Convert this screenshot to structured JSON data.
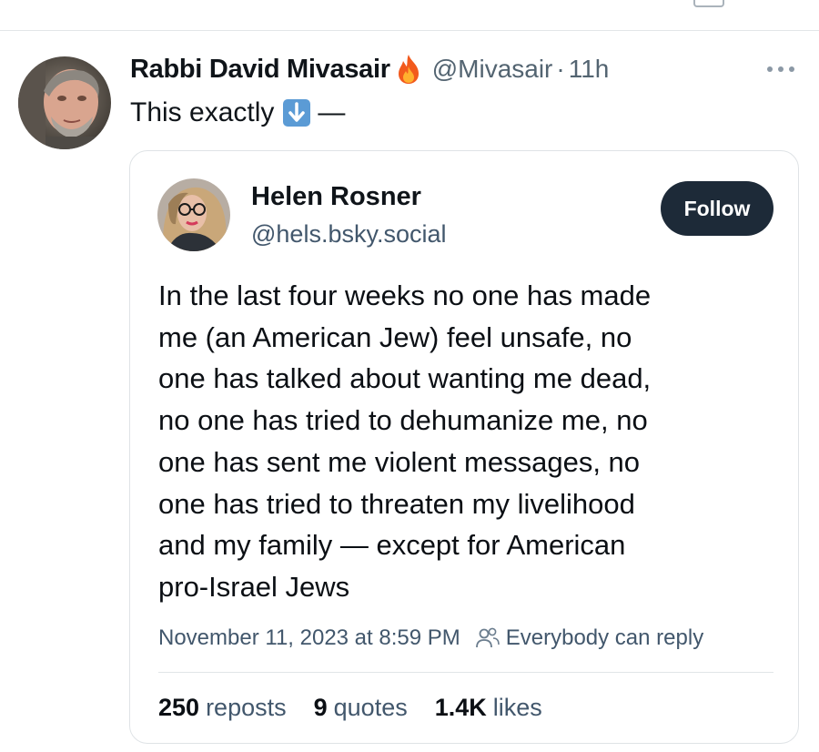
{
  "tweet": {
    "author_name": "Rabbi David Mivasair",
    "author_emoji": "fire-icon",
    "handle": "@Mivasair",
    "separator": "·",
    "time_ago": "11h",
    "text": "This exactly",
    "text_emoji": "arrow-down-icon",
    "text_suffix": "—"
  },
  "quoted_post": {
    "author_name": "Helen Rosner",
    "handle": "@hels.bsky.social",
    "follow_label": "Follow",
    "body_lines": [
      "In the last four weeks no one has made",
      "me (an American Jew) feel unsafe, no",
      "one has talked about wanting me dead,",
      "no one has tried to dehumanize me, no",
      "one has sent me violent messages, no",
      "one has tried to threaten my livelihood",
      "and my family — except for American",
      "pro-Israel Jews"
    ],
    "timestamp": "November 11, 2023 at 8:59 PM",
    "reply_setting": "Everybody can reply",
    "stats": {
      "reposts_count": "250",
      "reposts_label": "reposts",
      "quotes_count": "9",
      "quotes_label": "quotes",
      "likes_count": "1.4K",
      "likes_label": "likes"
    }
  },
  "colors": {
    "text_primary": "#0f1419",
    "text_secondary": "#536471",
    "follow_bg": "#1d2a38",
    "border": "#dfe3e6"
  }
}
